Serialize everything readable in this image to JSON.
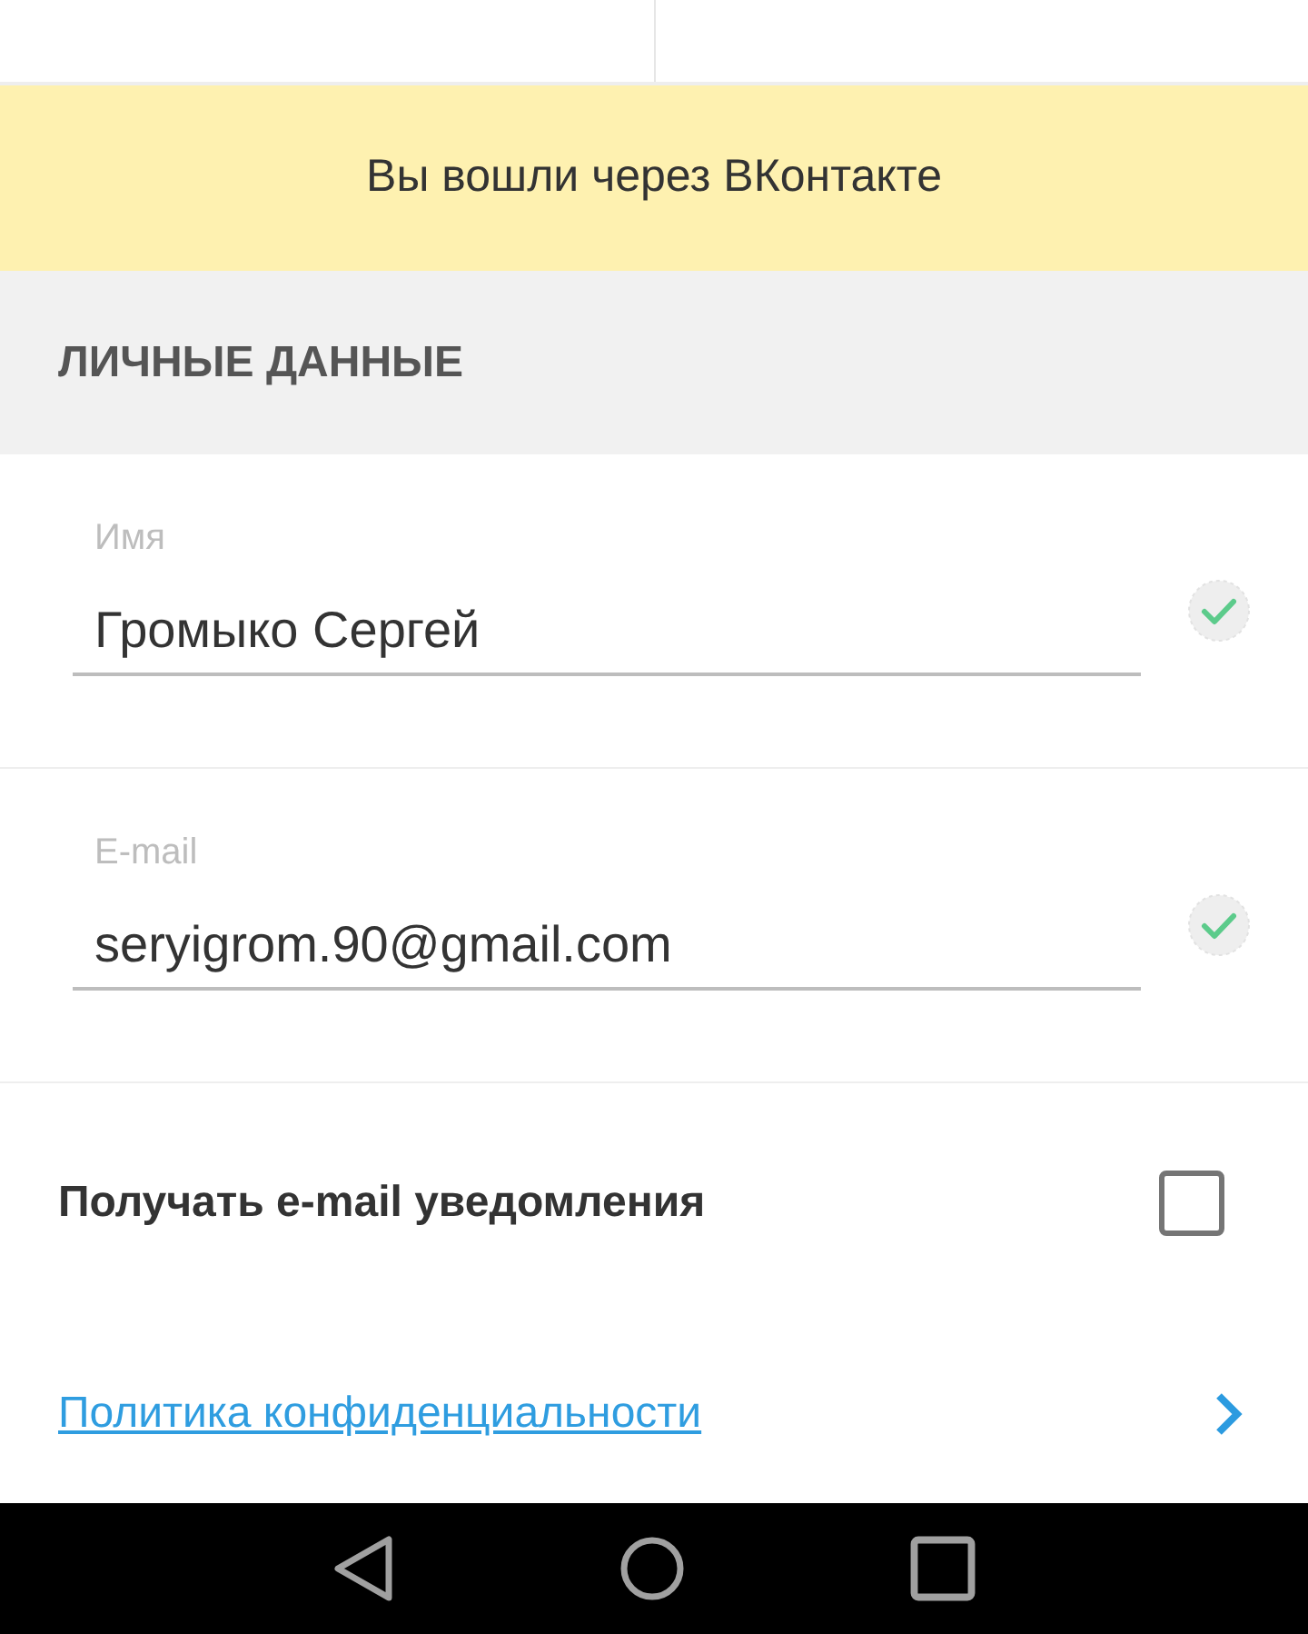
{
  "banner": {
    "text": "Вы вошли через ВКонтакте"
  },
  "section": {
    "title": "ЛИЧНЫЕ ДАННЫЕ"
  },
  "fields": [
    {
      "label": "Имя",
      "value": "Громыко Сергей",
      "valid": true
    },
    {
      "label": "E-mail",
      "value": "seryigrom.90@gmail.com",
      "valid": true
    }
  ],
  "notifications": {
    "label": "Получать e-mail уведомления",
    "checked": false
  },
  "privacy_link": {
    "text": "Политика конфиденциальности"
  }
}
